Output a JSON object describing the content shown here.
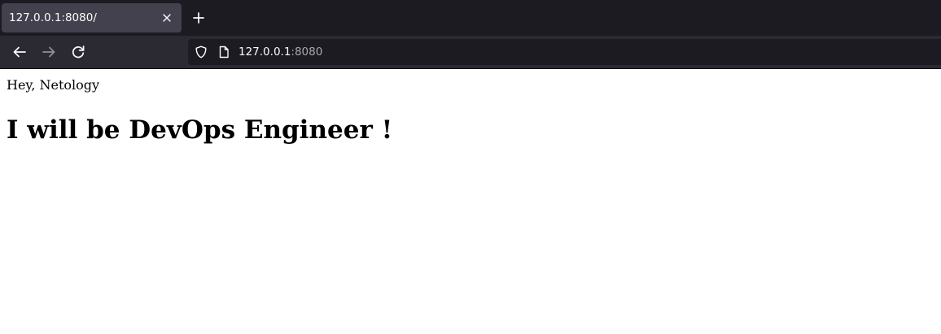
{
  "tab": {
    "title": "127.0.0.1:8080/"
  },
  "toolbar": {
    "back_icon": "back-arrow-icon",
    "forward_icon": "forward-arrow-icon",
    "reload_icon": "reload-icon",
    "new_tab_icon": "plus-icon",
    "close_tab_icon": "close-icon"
  },
  "urlbar": {
    "host": "127.0.0.1",
    "port": ":8080",
    "shield_icon": "shield-icon",
    "page_icon": "page-icon"
  },
  "page": {
    "greeting": "Hey, Netology",
    "headline": "I will be DevOps Engineer !"
  },
  "colors": {
    "tabstrip_bg": "#1c1b22",
    "active_tab_bg": "#42414d",
    "toolbar_bg": "#2b2a33",
    "urlbar_bg": "#1c1b22",
    "toolbar_text": "#fbfbfe",
    "port_text": "#a8a8b0",
    "page_bg": "#ffffff",
    "page_text": "#000000"
  }
}
